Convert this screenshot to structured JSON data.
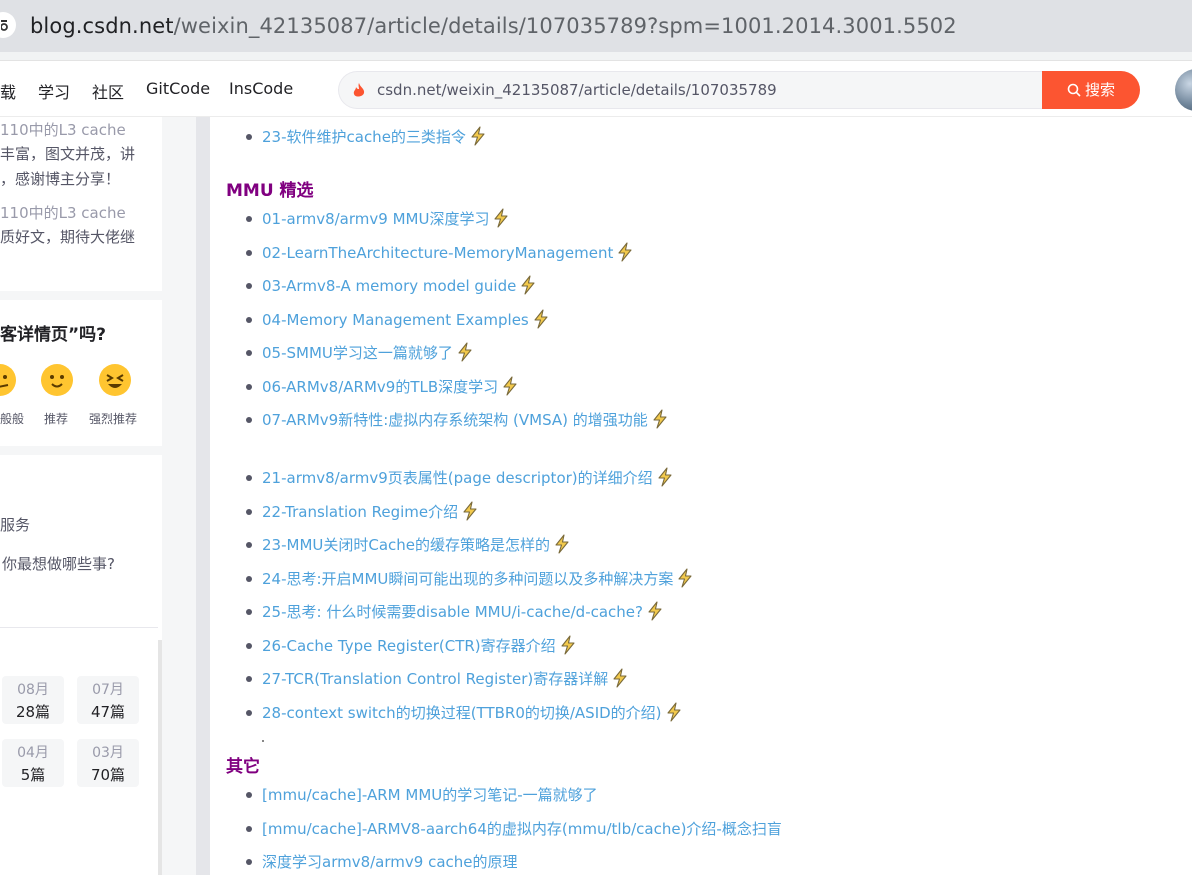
{
  "browser": {
    "url_host": "blog.csdn.net",
    "url_path": "/weixin_42135087/article/details/107035789?spm=1001.2014.3001.5502"
  },
  "nav": {
    "items": [
      "载",
      "学习",
      "社区",
      "GitCode",
      "InsCode"
    ],
    "search_value": "csdn.net/weixin_42135087/article/details/107035789",
    "search_button": "搜索"
  },
  "sidebar": {
    "comments": [
      {
        "link": "110中的L3 cache",
        "lines": [
          "丰富，图文并茂，讲",
          "，感谢博主分享！"
        ]
      },
      {
        "link": "110中的L3 cache",
        "lines": [
          "质好文，期待大佬继"
        ]
      }
    ],
    "question": "客详情页”吗?",
    "ratings": [
      "般般",
      "推荐",
      "强烈推荐"
    ],
    "lines": [
      "服务",
      "你最想做哪些事?"
    ],
    "archive": [
      {
        "month": "08月",
        "count": "28篇"
      },
      {
        "month": "07月",
        "count": "47篇"
      },
      {
        "month": "04月",
        "count": "5篇"
      },
      {
        "month": "03月",
        "count": "70篇"
      }
    ]
  },
  "content": {
    "top_item": "23-软件维护cache的三类指令",
    "mmu_title": "MMU 精选",
    "mmu_items": [
      "01-armv8/armv9 MMU深度学习",
      "02-LearnTheArchitecture-MemoryManagement",
      "03-Armv8-A memory model guide",
      "04-Memory Management Examples",
      "05-SMMU学习这一篇就够了",
      "06-ARMv8/ARMv9的TLB深度学习",
      "07-ARMv9新特性:虚拟内存系统架构 (VMSA) 的增强功能"
    ],
    "mmu_items2": [
      "21-armv8/armv9页表属性(page descriptor)的详细介绍",
      "22-Translation Regime介绍",
      "23-MMU关闭时Cache的缓存策略是怎样的",
      "24-思考:开启MMU瞬间可能出现的多种问题以及多种解决方案",
      "25-思考: 什么时候需要disable MMU/i-cache/d-cache?",
      "26-Cache Type Register(CTR)寄存器介绍",
      "27-TCR(Translation Control Register)寄存器详解",
      "28-context switch的切换过程(TTBR0的切换/ASID的介绍)"
    ],
    "other_title": "其它",
    "other_items": [
      "[mmu/cache]-ARM MMU的学习笔记-一篇就够了",
      "[mmu/cache]-ARMV8-aarch64的虚拟内存(mmu/tlb/cache)介绍-概念扫盲",
      "深度学习armv8/armv9 cache的原理"
    ]
  },
  "colors": {
    "link": "#4ea1db",
    "section_title": "#800080",
    "search_button": "#fc5531",
    "bolt": "#f2c94c"
  }
}
